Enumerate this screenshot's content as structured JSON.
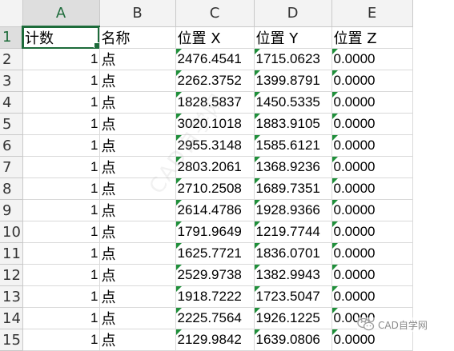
{
  "columns": [
    "A",
    "B",
    "C",
    "D",
    "E"
  ],
  "rows": [
    {
      "n": "1",
      "a": "计数",
      "b": "名称",
      "c": "位置 X",
      "d": "位置 Y",
      "e": "位置 Z"
    },
    {
      "n": "2",
      "a": "1",
      "b": "点",
      "c": "2476.4541",
      "d": "1715.0623",
      "e": "0.0000"
    },
    {
      "n": "3",
      "a": "1",
      "b": "点",
      "c": "2262.3752",
      "d": "1399.8791",
      "e": "0.0000"
    },
    {
      "n": "4",
      "a": "1",
      "b": "点",
      "c": "1828.5837",
      "d": "1450.5335",
      "e": "0.0000"
    },
    {
      "n": "5",
      "a": "1",
      "b": "点",
      "c": "3020.1018",
      "d": "1883.9105",
      "e": "0.0000"
    },
    {
      "n": "6",
      "a": "1",
      "b": "点",
      "c": "2955.3148",
      "d": "1585.6121",
      "e": "0.0000"
    },
    {
      "n": "7",
      "a": "1",
      "b": "点",
      "c": "2803.2061",
      "d": "1368.9236",
      "e": "0.0000"
    },
    {
      "n": "8",
      "a": "1",
      "b": "点",
      "c": "2710.2508",
      "d": "1689.7351",
      "e": "0.0000"
    },
    {
      "n": "9",
      "a": "1",
      "b": "点",
      "c": "2614.4786",
      "d": "1928.9366",
      "e": "0.0000"
    },
    {
      "n": "10",
      "a": "1",
      "b": "点",
      "c": "1791.9649",
      "d": "1219.7744",
      "e": "0.0000"
    },
    {
      "n": "11",
      "a": "1",
      "b": "点",
      "c": "1625.7721",
      "d": "1836.0701",
      "e": "0.0000"
    },
    {
      "n": "12",
      "a": "1",
      "b": "点",
      "c": "2529.9738",
      "d": "1382.9943",
      "e": "0.0000"
    },
    {
      "n": "13",
      "a": "1",
      "b": "点",
      "c": "1918.7222",
      "d": "1723.5047",
      "e": "0.0000"
    },
    {
      "n": "14",
      "a": "1",
      "b": "点",
      "c": "2225.7564",
      "d": "1926.1225",
      "e": "0.0000"
    },
    {
      "n": "15",
      "a": "1",
      "b": "点",
      "c": "2129.9842",
      "d": "1639.0806",
      "e": "0.0000"
    }
  ],
  "watermark": {
    "diagonal_text": "CAD自学网",
    "logo_text": "CAD自学网"
  },
  "colors": {
    "selection": "#1d6b3a",
    "error_triangle": "#1f8f3a",
    "header_bg": "#f3f3f3"
  }
}
